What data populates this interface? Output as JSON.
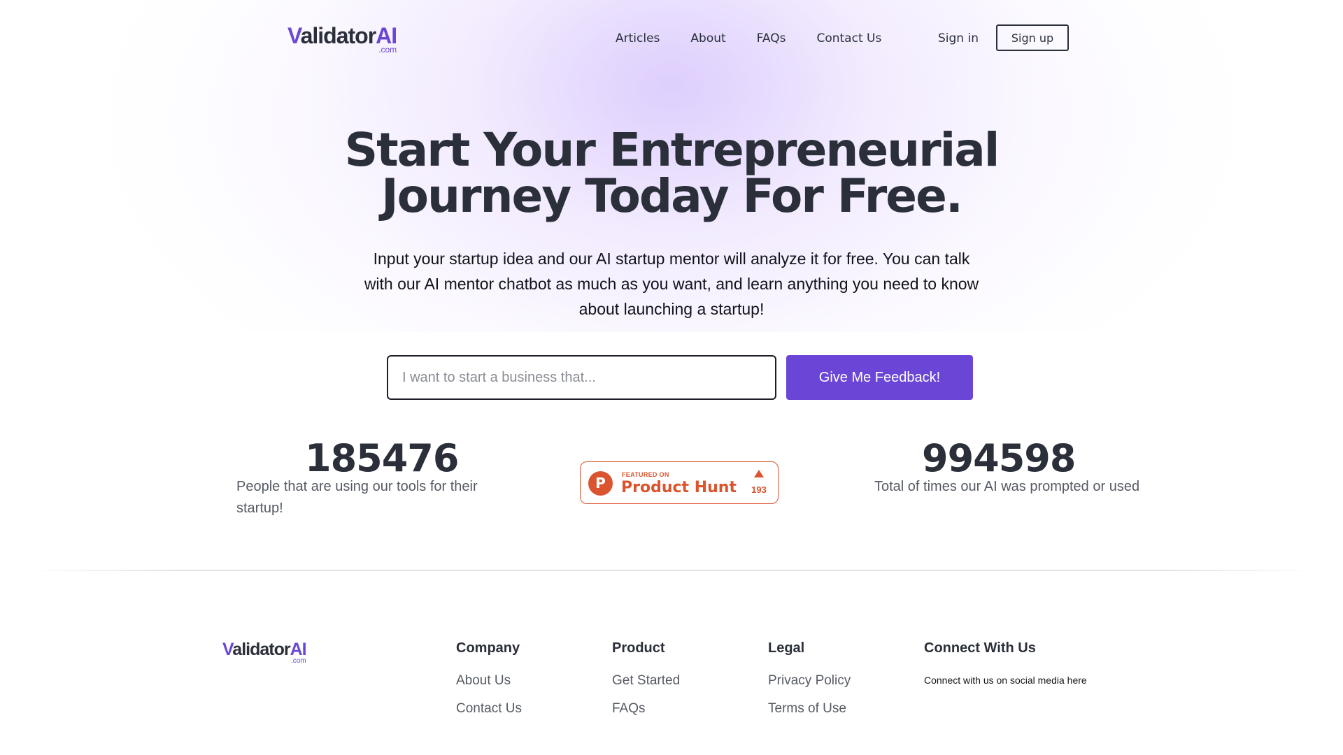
{
  "header": {
    "logo": {
      "v": "V",
      "word": "alidator",
      "ai": "AI",
      "com": ".com"
    },
    "nav": [
      {
        "label": "Articles"
      },
      {
        "label": "About"
      },
      {
        "label": "FAQs"
      },
      {
        "label": "Contact Us"
      }
    ],
    "sign_in": "Sign in",
    "sign_up": "Sign up"
  },
  "hero": {
    "headline_line1": "Start Your Entrepreneurial",
    "headline_line2": "Journey Today For Free.",
    "subtext": "Input your startup idea and our AI startup mentor will analyze it for free. You can talk with our AI mentor chatbot as much as you want, and learn anything you need to know about launching a startup!",
    "input_placeholder": "I want to start a business that...",
    "input_value": "",
    "cta": "Give Me Feedback!"
  },
  "stats": {
    "users": {
      "value": "185476",
      "label": "People that are using our tools for their startup!"
    },
    "prompts": {
      "value": "994598",
      "label": "Total of times our AI was prompted or used"
    }
  },
  "product_hunt": {
    "featured": "FEATURED ON",
    "name": "Product Hunt",
    "logo_letter": "P",
    "upvotes": "193"
  },
  "footer": {
    "logo": {
      "v": "V",
      "word": "alidator",
      "ai": "AI",
      "com": ".com"
    },
    "columns": [
      {
        "heading": "Company",
        "links": [
          "About Us",
          "Contact Us"
        ]
      },
      {
        "heading": "Product",
        "links": [
          "Get Started",
          "FAQs"
        ]
      },
      {
        "heading": "Legal",
        "links": [
          "Privacy Policy",
          "Terms of Use"
        ]
      },
      {
        "heading": "Connect With Us",
        "note": "Connect with us on social media here"
      }
    ]
  },
  "colors": {
    "accent": "#6b46d6",
    "text_dark": "#2b2f3a",
    "text_muted": "#555a63",
    "product_hunt": "#da552f",
    "hero_glow": "#e9ddfd"
  },
  "icons": [
    "product-hunt-logo-icon",
    "upvote-arrow-icon"
  ]
}
